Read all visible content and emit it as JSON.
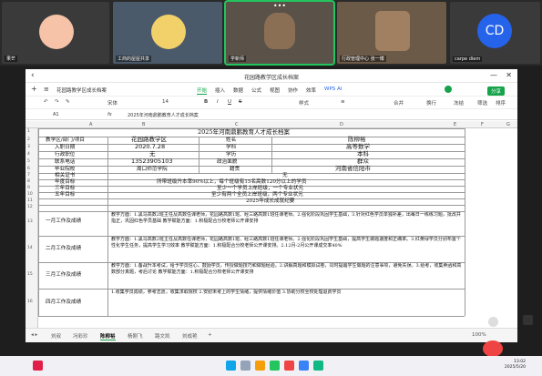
{
  "meeting": {
    "participants": [
      {
        "name": "果芒"
      },
      {
        "name": "工商的屋屋共享"
      },
      {
        "name": "学新师"
      },
      {
        "name": "行政管理中心 张一博"
      },
      {
        "name": "carpe diem",
        "initials": "CD"
      }
    ]
  },
  "window": {
    "title": "花园路教学区成长档案",
    "back": "‹",
    "minimize": "—",
    "close": "✕"
  },
  "menu": {
    "file_label": "花园路教学区成长档案",
    "tabs": [
      "开始",
      "插入",
      "数据",
      "公式",
      "视图",
      "协作",
      "效率",
      "WPS AI"
    ],
    "active_tab": "开始",
    "share_label": "分享"
  },
  "toolbar": {
    "font": "宋体",
    "size": "14",
    "style_label": "样式",
    "merge_label": "合并",
    "wrap_label": "换行",
    "freeze_label": "冻结",
    "filter_label": "筛选",
    "sort_label": "排序"
  },
  "formula": {
    "cell_ref": "A1",
    "fx": "fx",
    "content": "2025年河南鼎鹏教育人才成长档案"
  },
  "columns": [
    "A",
    "B",
    "C",
    "D",
    "E",
    "F",
    "G"
  ],
  "rows": [
    "1",
    "2",
    "3",
    "4",
    "5",
    "6",
    "7",
    "8",
    "9",
    "10",
    "11",
    "12",
    "13",
    "14",
    "15",
    "16",
    "17",
    "18",
    "19",
    "20"
  ],
  "sheet": {
    "title": "2025年河南鼎鹏教育人才成长档案",
    "info": [
      {
        "l1": "教学区/部门/项目",
        "v1": "花园路教学区",
        "l2": "姓名",
        "v2": "陈柳裕"
      },
      {
        "l1": "入职日期",
        "v1": "2020.7.28",
        "l2": "学科",
        "v2": "高等数学"
      },
      {
        "l1": "行政职位",
        "v1": "无",
        "l2": "学历",
        "v2": "本科"
      },
      {
        "l1": "联系电话",
        "v1": "13523905103",
        "l2": "政治面貌",
        "v2": "群众"
      },
      {
        "l1": "毕业院校",
        "v1": "周口师范学院",
        "l2": "籍贯",
        "v2": "河南省信阳市"
      }
    ],
    "cert_label": "相关证书",
    "cert_value": "无",
    "goal_label": "年度目标",
    "goal_value": "所带班级升本率90%以上，每个班级有15名高数120分以上的学员",
    "q3_label": "三年目标",
    "q3_value": "至少一个学员上岸班级，一个专业状元",
    "q5_label": "五年目标",
    "q5_value": "至少有两个全员上岸班级，两个专业状元",
    "record_title": "2025年成长成就纪要",
    "months": [
      {
        "label": "一月工作及成绩",
        "text": "教学方面：1.黑马高数2班主任及高数任课老师，花园路高数1班、经三路高数1班任课老师。2.强化阶段巩固学生基础，3.针对红色学员单独补差，出每日一练练习题，批改并指正，巩固红色学员基础 教学赋能方面：1.积极配合分校老师公开课安排"
      },
      {
        "label": "二月工作及成绩",
        "text": "教学方面：1.黑马高数2班主任及高数任课老师，花园路高数1班、经三路高数1班任课老师。2.强化阶段巩固学生基础，提高学生做题速度和正确率。3.红黄绿学员分别布置个性化学生任务，提高学生学习效率 教学赋能方面：1.积极配合分校老师公开课安排。2.12月-2月公开课成交率40%"
      },
      {
        "label": "三月工作及成绩",
        "text": "教学方面：1.备战升本考试，给予学员信心，鼓励学员，传授做题技巧和做题经验。2.讲解真题和模拟试卷，同时提醒学生做题的注意事项，避免失误。3.给考，收集卖函和高数部分真题，考后讨论 教学赋能方面：1.积极配合分校老师公开课安排"
      },
      {
        "label": "四月工作及成绩",
        "text": "1.收集学员成绩，参考志愿，收集求取院校 2.安慰未考上的学生情绪，提供情绪价值 3.协助分校全校处理退费学员"
      }
    ]
  },
  "sheets": {
    "tabs": [
      "刘叔",
      "冯彩珍",
      "陈柳裕",
      "杨刚飞",
      "路文凯",
      "刘成艳"
    ],
    "active": "陈柳裕"
  },
  "status": {
    "zoom": "100%"
  },
  "clock": {
    "time": "13:02",
    "date": "2025/5/20"
  },
  "colors": {
    "accent": "#16a34a",
    "active_tile": "#22c55e",
    "cd_avatar": "#2563eb"
  }
}
